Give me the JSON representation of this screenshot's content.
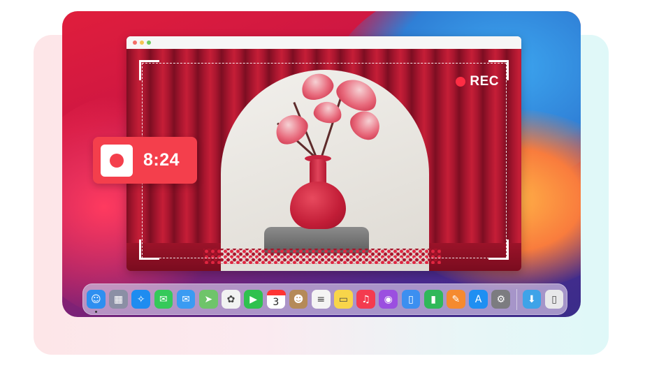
{
  "recording_badge": {
    "label": "REC",
    "accent": "#ff2d44"
  },
  "timer_widget": {
    "elapsed": "8:24",
    "background": "#f43f4c"
  },
  "window": {
    "traffic_lights": [
      "close",
      "minimize",
      "zoom"
    ]
  },
  "dock": {
    "apps": [
      {
        "name": "Finder",
        "icon": "finder-icon",
        "glyph": "☺",
        "color": "#2e8ff0",
        "running": true
      },
      {
        "name": "Launchpad",
        "icon": "launchpad-icon",
        "glyph": "▦",
        "color": "#8b8fa5"
      },
      {
        "name": "Safari",
        "icon": "safari-icon",
        "glyph": "✧",
        "color": "#1e8cf0"
      },
      {
        "name": "Messages",
        "icon": "messages-icon",
        "glyph": "✉",
        "color": "#35c95a"
      },
      {
        "name": "Mail",
        "icon": "mail-icon",
        "glyph": "✉",
        "color": "#3a9bf2"
      },
      {
        "name": "Maps",
        "icon": "maps-icon",
        "glyph": "➤",
        "color": "#6fc46a"
      },
      {
        "name": "Photos",
        "icon": "photos-icon",
        "glyph": "✿",
        "color": "#f2f2f2"
      },
      {
        "name": "FaceTime",
        "icon": "facetime-icon",
        "glyph": "▶",
        "color": "#2fc14f"
      },
      {
        "name": "Calendar",
        "icon": "calendar-icon",
        "glyph": "3",
        "color": "#ffffff"
      },
      {
        "name": "Contacts",
        "icon": "contacts-icon",
        "glyph": "☻",
        "color": "#b58a58"
      },
      {
        "name": "Reminders",
        "icon": "reminders-icon",
        "glyph": "≡",
        "color": "#f4f4f4"
      },
      {
        "name": "Notes",
        "icon": "notes-icon",
        "glyph": "▭",
        "color": "#f8d54a"
      },
      {
        "name": "Music",
        "icon": "music-icon",
        "glyph": "♫",
        "color": "#f43b4f"
      },
      {
        "name": "Podcasts",
        "icon": "podcasts-icon",
        "glyph": "◉",
        "color": "#9b4fe0"
      },
      {
        "name": "Keynote",
        "icon": "keynote-icon",
        "glyph": "▯",
        "color": "#3c8ff0"
      },
      {
        "name": "Numbers",
        "icon": "numbers-icon",
        "glyph": "▮",
        "color": "#2fb85a"
      },
      {
        "name": "Pages",
        "icon": "pages-icon",
        "glyph": "✎",
        "color": "#f58a2f"
      },
      {
        "name": "App Store",
        "icon": "app-store-icon",
        "glyph": "A",
        "color": "#1f8ff2"
      },
      {
        "name": "System Preferences",
        "icon": "system-preferences-icon",
        "glyph": "⚙",
        "color": "#7c7c80"
      }
    ],
    "folders": [
      {
        "name": "Downloads",
        "icon": "downloads-folder-icon",
        "glyph": "⬇",
        "color": "#3ea3e8"
      },
      {
        "name": "Trash",
        "icon": "trash-icon",
        "glyph": "▯",
        "color": "#e8e8ea"
      }
    ]
  }
}
